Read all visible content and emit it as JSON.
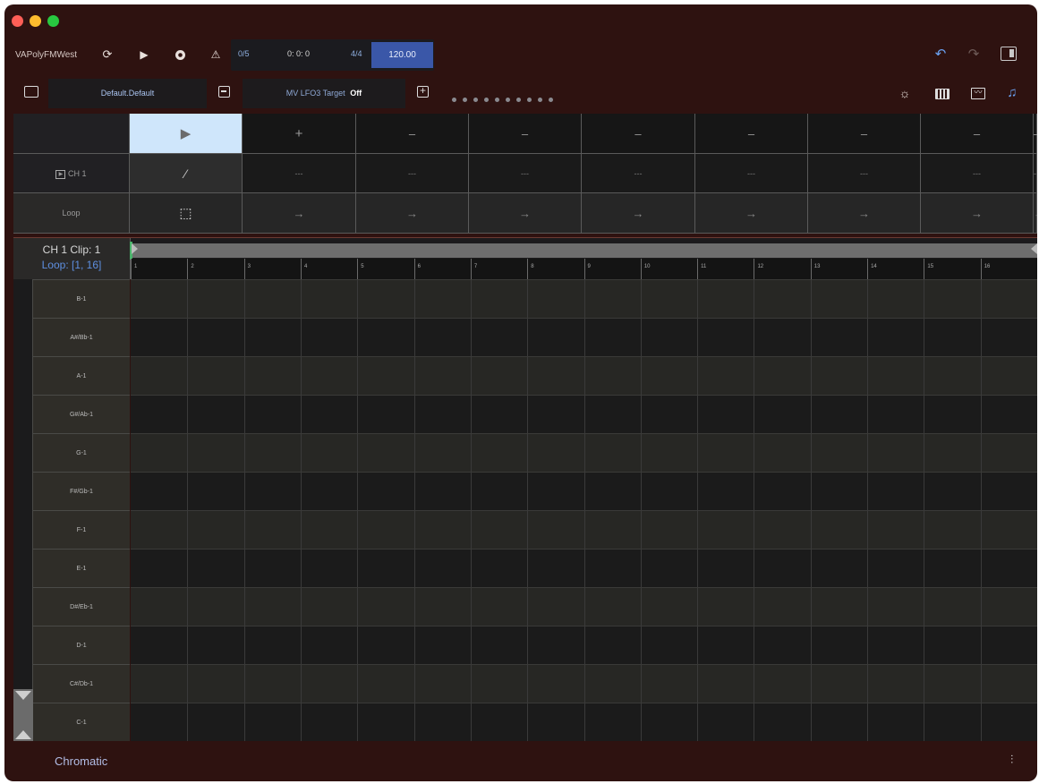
{
  "project_name": "VAPolyFMWest",
  "transport": {
    "bar_position": "0/5",
    "time": "0: 0: 0",
    "time_signature": "4/4",
    "tempo": "120.00"
  },
  "preset_name": "Default.Default",
  "mod_target": {
    "label": "MV LFO3 Target",
    "value": "Off"
  },
  "launcher": {
    "header_row": [
      "▶",
      "+",
      "–",
      "–",
      "–",
      "–",
      "–",
      "–",
      "–"
    ],
    "channel_label": "CH 1",
    "channel_row": [
      "⁄",
      "---",
      "---",
      "---",
      "---",
      "---",
      "---",
      "---",
      "---"
    ],
    "loop_label": "Loop",
    "loop_row": [
      "⬚",
      "→",
      "→",
      "→",
      "→",
      "→",
      "→",
      "→",
      "→"
    ]
  },
  "clip": {
    "title": "CH 1 Clip: 1",
    "loop": "Loop: [1, 16]"
  },
  "steps": [
    "1",
    "2",
    "3",
    "4",
    "5",
    "6",
    "7",
    "8",
    "9",
    "10",
    "11",
    "12",
    "13",
    "14",
    "15",
    "16"
  ],
  "notes": [
    "B-1",
    "A#/Bb-1",
    "A-1",
    "G#/Ab-1",
    "G-1",
    "F#/Gb-1",
    "F-1",
    "E-1",
    "D#/Eb-1",
    "D-1",
    "C#/Db-1",
    "C-1"
  ],
  "scale": "Chromatic",
  "colors": {
    "window_bg": "#2e1210",
    "accent": "#3a57a8",
    "selected_cell": "#cfe6fb"
  }
}
